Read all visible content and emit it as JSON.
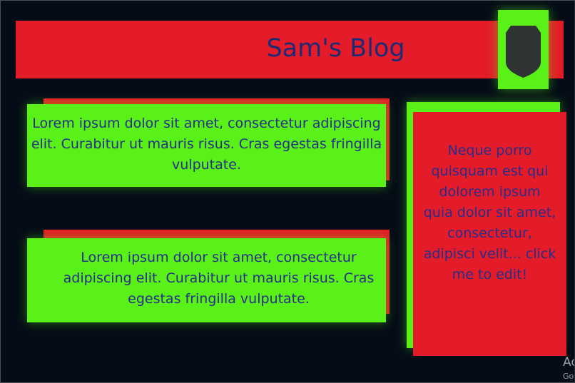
{
  "header": {
    "title": "Sam's Blog",
    "badge_icon": "shield-icon"
  },
  "posts": [
    {
      "text": "Lorem ipsum dolor sit amet, consectetur adipiscing elit. Curabitur ut mauris risus. Cras egestas fringilla vulputate."
    },
    {
      "text": "Lorem ipsum dolor sit amet, consectetur adipiscing elit. Curabitur ut mauris risus. Cras egestas fringilla vulputate."
    }
  ],
  "sidebar": {
    "text": "Neque porro quisquam est qui dolorem ipsum quia dolor sit amet, consectetur, adipisci velit... click me to edit!"
  },
  "watermark": {
    "line1": "Ac",
    "line2": "Go"
  },
  "colors": {
    "background": "#050c17",
    "red": "#e41b28",
    "green": "#59f117",
    "text_navy": "#272e8a",
    "shield": "#2f3334"
  }
}
